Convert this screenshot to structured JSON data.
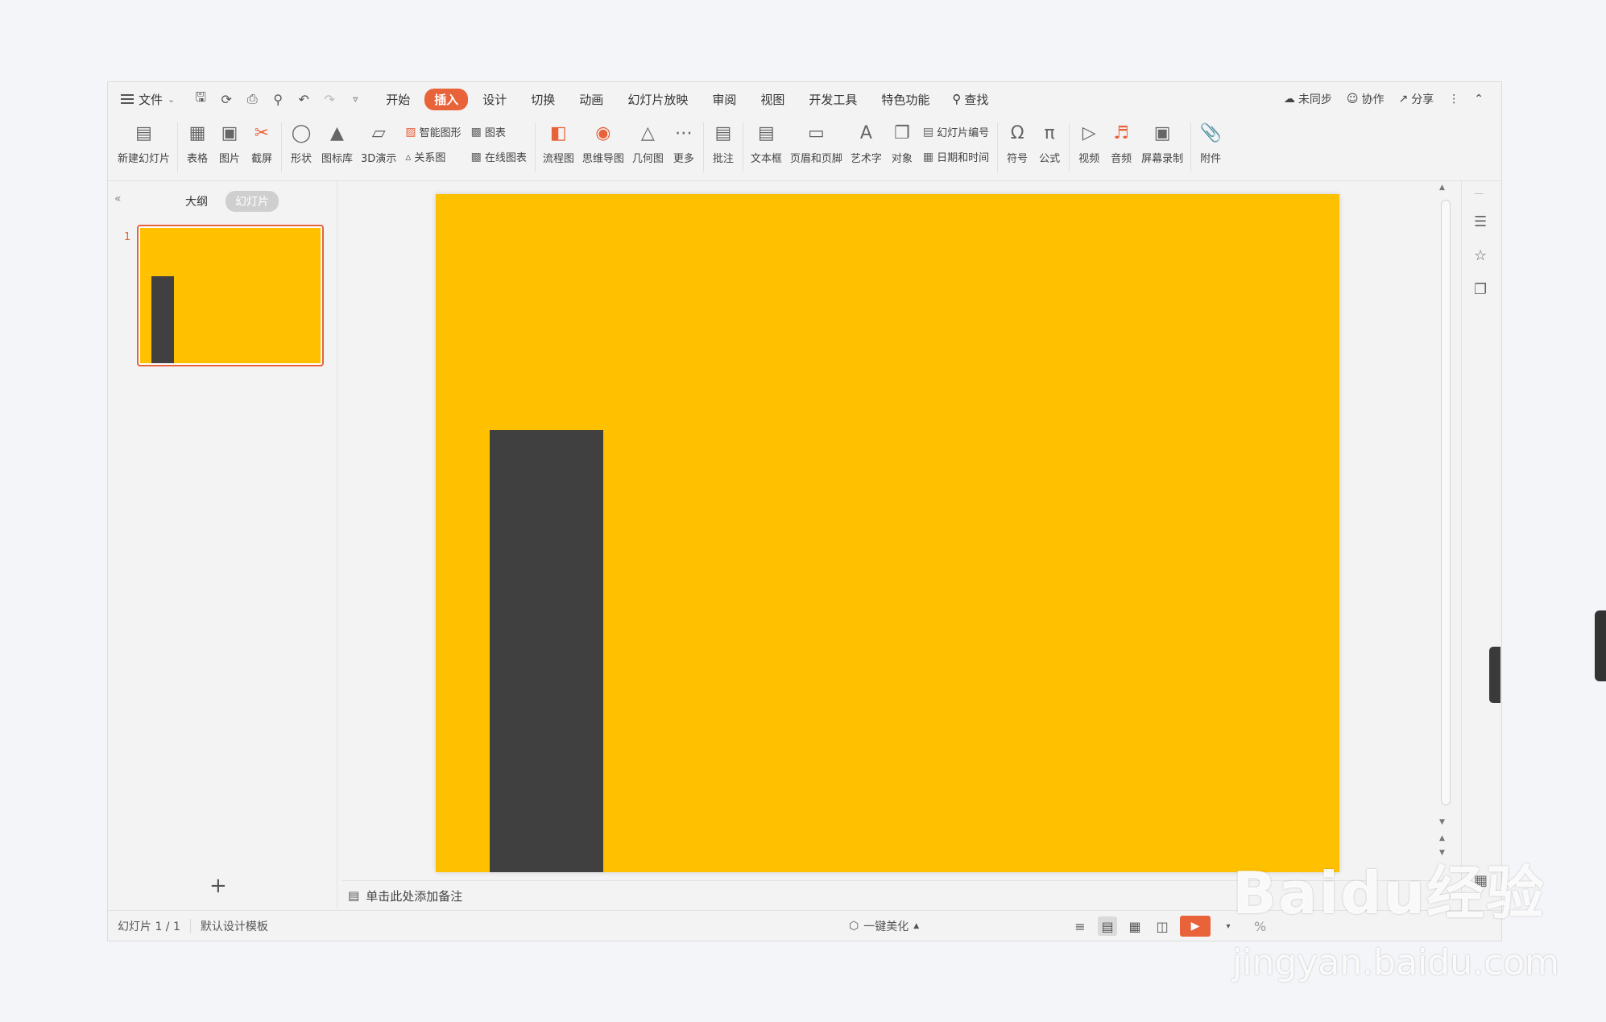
{
  "colors": {
    "slide_bg": "#FFC000",
    "rect_fill": "#404040",
    "accent": "#E8623A"
  },
  "menubar": {
    "file_label": "文件",
    "tabs": [
      {
        "label": "开始",
        "active": false
      },
      {
        "label": "插入",
        "active": true
      },
      {
        "label": "设计",
        "active": false
      },
      {
        "label": "切换",
        "active": false
      },
      {
        "label": "动画",
        "active": false
      },
      {
        "label": "幻灯片放映",
        "active": false
      },
      {
        "label": "审阅",
        "active": false
      },
      {
        "label": "视图",
        "active": false
      },
      {
        "label": "开发工具",
        "active": false
      },
      {
        "label": "特色功能",
        "active": false
      }
    ],
    "find_label": "查找",
    "right": {
      "sync": "未同步",
      "collab": "协作",
      "share": "分享"
    }
  },
  "ribbon": {
    "new_slide": "新建幻灯片",
    "table": "表格",
    "picture": "图片",
    "screenshot": "截屏",
    "shape": "形状",
    "icon_library": "图标库",
    "demo3d": "3D演示",
    "smart_art": "智能图形",
    "chart": "图表",
    "relation": "关系图",
    "online_chart": "在线图表",
    "flowchart": "流程图",
    "mindmap": "思维导图",
    "geometry": "几何图",
    "more": "更多",
    "comment": "批注",
    "textbox": "文本框",
    "header_footer": "页眉和页脚",
    "wordart": "艺术字",
    "object": "对象",
    "slide_number": "幻灯片编号",
    "date_time": "日期和时间",
    "symbol": "符号",
    "formula": "公式",
    "video": "视频",
    "audio": "音频",
    "screen_record": "屏幕录制",
    "attachment": "附件"
  },
  "leftpanel": {
    "outline_tab": "大纲",
    "slides_tab": "幻灯片",
    "slide_number": "1"
  },
  "notes": {
    "placeholder": "单击此处添加备注"
  },
  "status": {
    "slide_count": "幻灯片 1 / 1",
    "template": "默认设计模板",
    "beautify": "一键美化"
  },
  "watermark": {
    "brand": "Baidu经验",
    "url": "jingyan.baidu.com"
  }
}
